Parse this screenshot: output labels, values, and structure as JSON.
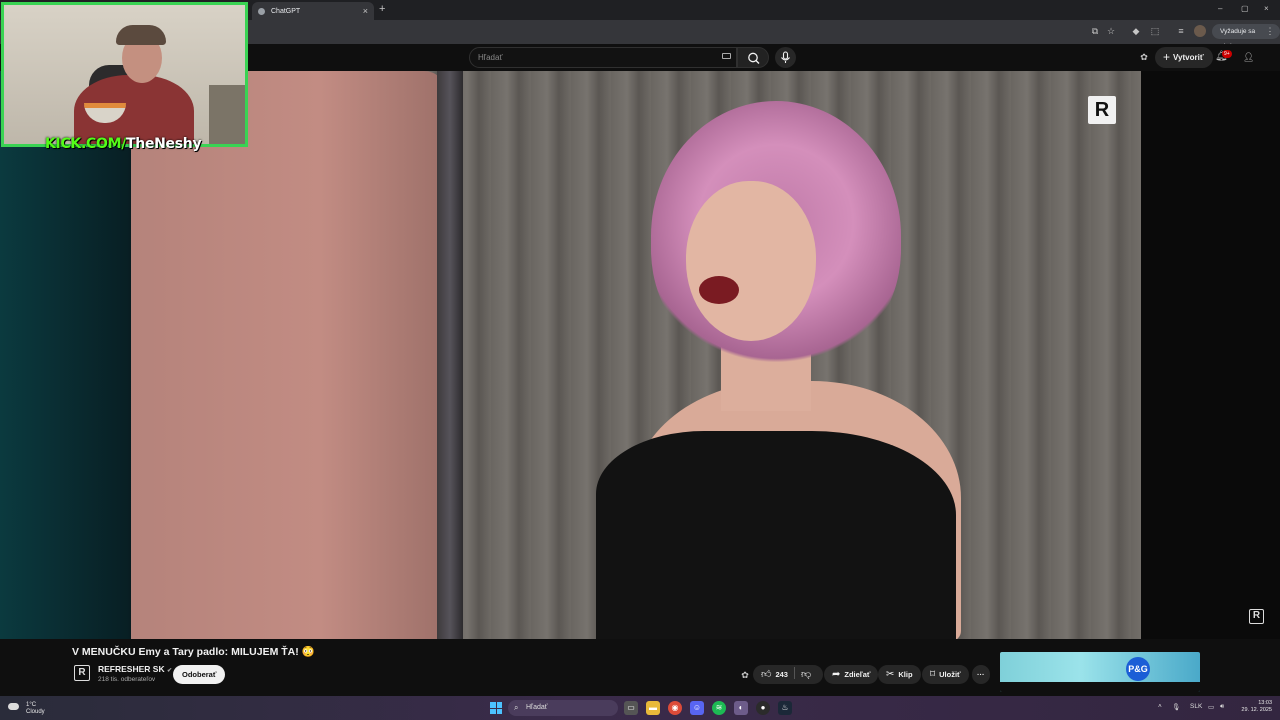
{
  "browser": {
    "tab_title": "ChatGPT",
    "tab_close": "×",
    "new_tab": "+",
    "window_controls": [
      "–",
      "▢",
      "×"
    ],
    "action_pill": "Vyžaduje sa akcia"
  },
  "youtube_header": {
    "search_placeholder": "Hľadať",
    "create_label": "Vytvoriť",
    "notification_count": "9+"
  },
  "webcam_overlay": {
    "url_prefix": "KICK.COM/",
    "channel": "TheNeshy",
    "accent_color": "#53fc18"
  },
  "video": {
    "title": "V MENUČKU Emy a Tary padlo: MILUJEM ŤA! 😳",
    "channel_name": "REFRESHER SK",
    "verified": "✔",
    "subscribers": "218 tis. odberateľov",
    "subscribe_label": "Odoberať",
    "like_count": "243",
    "share_label": "Zdieľať",
    "clip_label": "Klip",
    "save_label": "Uložiť",
    "more_label": "···"
  },
  "ad": {
    "brand": "P&G"
  },
  "taskbar": {
    "weather_temp": "1°C",
    "weather_desc": "Cloudy",
    "search_label": "Hľadať",
    "language": "SLK",
    "time": "13:03",
    "date": "29. 12. 2025"
  }
}
